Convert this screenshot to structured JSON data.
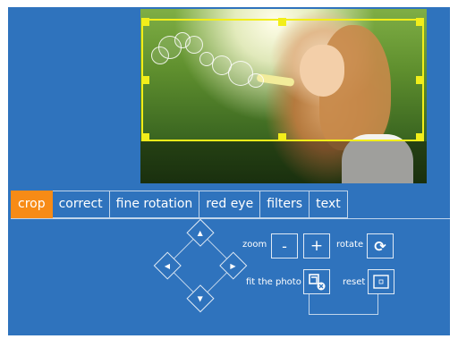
{
  "tabs": [
    {
      "label": "crop",
      "active": true
    },
    {
      "label": "correct",
      "active": false
    },
    {
      "label": "fine rotation",
      "active": false
    },
    {
      "label": "red eye",
      "active": false
    },
    {
      "label": "filters",
      "active": false
    },
    {
      "label": "text",
      "active": false
    }
  ],
  "controls": {
    "zoom_label": "zoom",
    "zoom_out": "-",
    "zoom_in": "+",
    "rotate_label": "rotate",
    "fit_label": "fit the photo",
    "reset_label": "reset"
  },
  "colors": {
    "background": "#2f73bd",
    "active_tab": "#f78b16",
    "crop_frame": "#f2ee1a"
  },
  "icons": {
    "pan_up": "▲",
    "pan_down": "▼",
    "pan_left": "◀",
    "pan_right": "▶",
    "rotate": "⟳"
  }
}
